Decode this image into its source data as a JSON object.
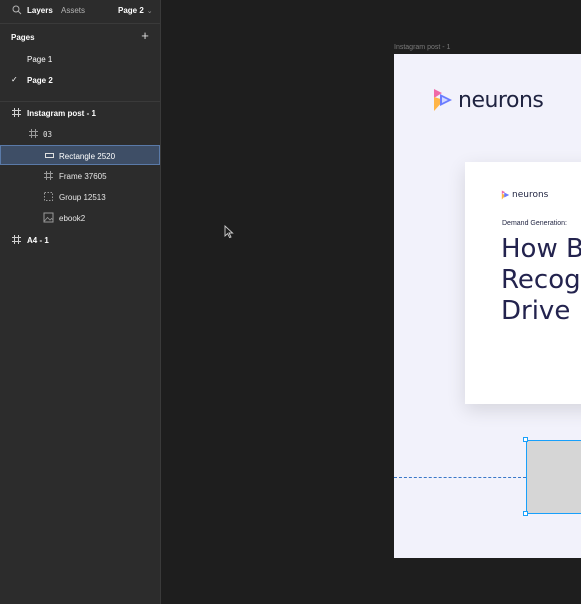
{
  "topbar": {
    "tabs": [
      "Layers",
      "Assets"
    ],
    "active_tab": "Layers",
    "current_page": "Page 2",
    "search_icon": "search-icon",
    "chevron_icon": "chevron-down-icon"
  },
  "pages": {
    "header": "Pages",
    "add_icon": "plus-icon",
    "items": [
      {
        "label": "Page 1",
        "active": false
      },
      {
        "label": "Page 2",
        "active": true
      }
    ]
  },
  "layers": [
    {
      "label": "Instagram post - 1",
      "icon": "frame-icon",
      "selected": false
    },
    {
      "label": "03",
      "icon": "frame-icon",
      "selected": false
    },
    {
      "label": "Rectangle 2520",
      "icon": "rectangle-icon",
      "selected": true
    },
    {
      "label": "Frame 37605",
      "icon": "frame-icon",
      "selected": false
    },
    {
      "label": "Group 12513",
      "icon": "group-icon",
      "selected": false
    },
    {
      "label": "ebook2",
      "icon": "image-icon",
      "selected": false
    },
    {
      "label": "A4 - 1",
      "icon": "frame-icon",
      "selected": false
    }
  ],
  "canvas": {
    "frame_label": "Instagram post - 1",
    "brand_name": "neurons",
    "card": {
      "brand_name": "neurons",
      "kicker": "Demand Generation:",
      "headline_lines": [
        "How B",
        "Recog",
        "Drive I"
      ]
    }
  },
  "colors": {
    "panel_bg": "#2c2c2c",
    "canvas_bg": "#1e1e1e",
    "selection_bg": "#3e4e66",
    "selection_blue": "#18a0fb",
    "frame_bg": "#f2f2fb",
    "headline": "#23234e"
  }
}
